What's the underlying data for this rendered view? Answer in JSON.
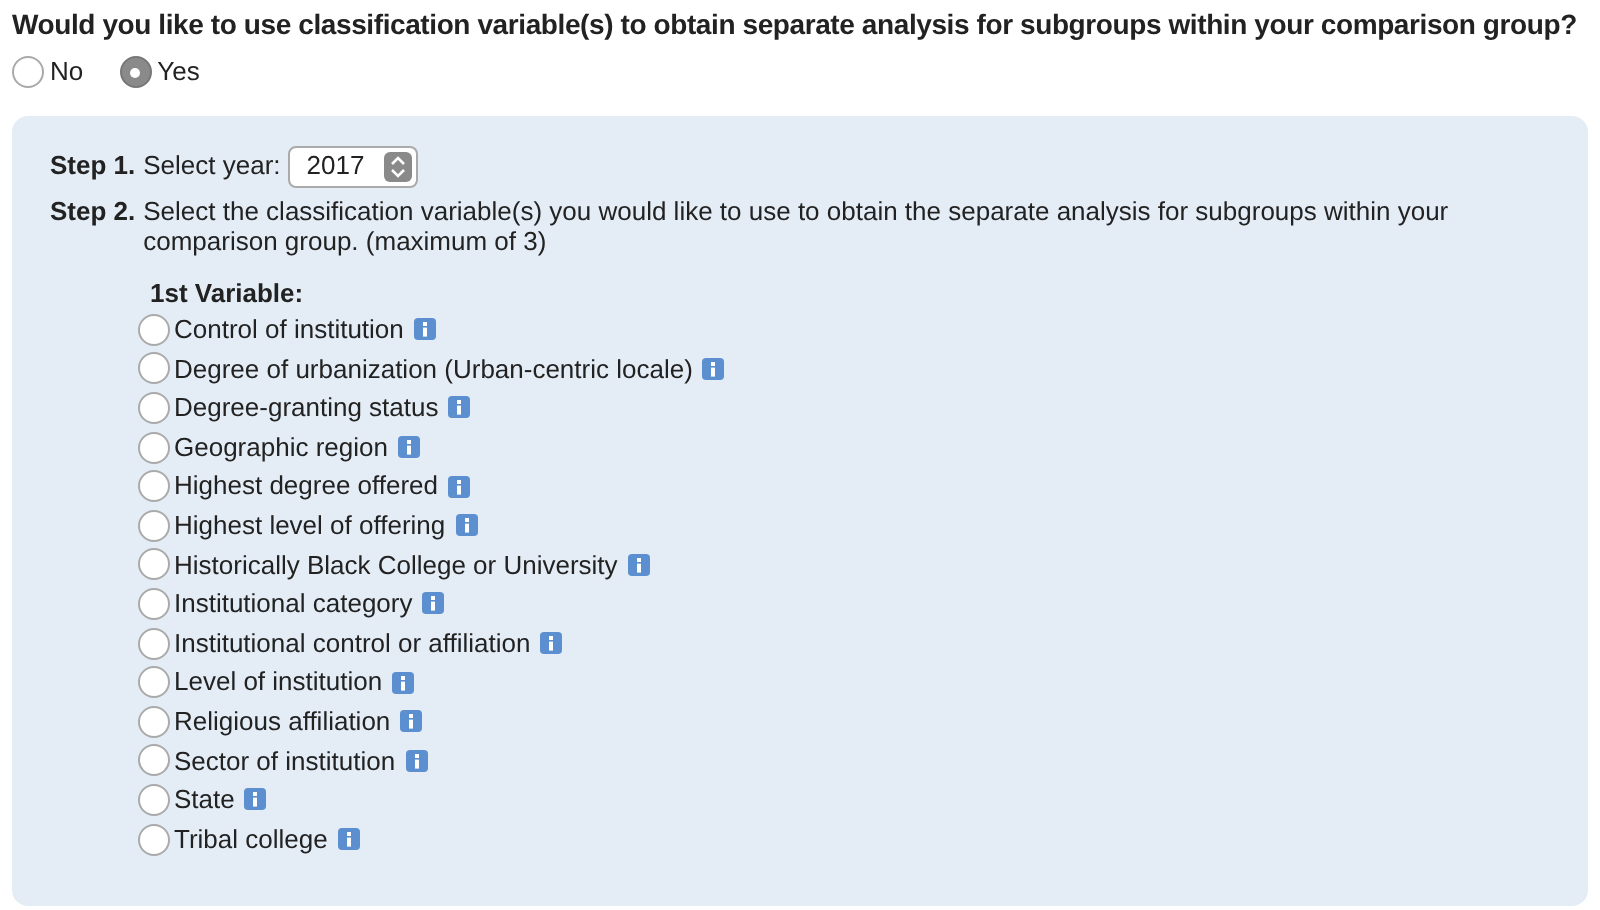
{
  "question": "Would you like to use classification variable(s) to obtain separate analysis for subgroups within your comparison group?",
  "answers": [
    {
      "label": "No",
      "selected": false
    },
    {
      "label": "Yes",
      "selected": true
    }
  ],
  "step1": {
    "step": "Step 1.",
    "label": "Select year:",
    "value": "2017"
  },
  "step2": {
    "step": "Step 2.",
    "text": "Select the classification variable(s) you would like to use to obtain the separate analysis for subgroups within your comparison group. (maximum of 3)"
  },
  "variable_heading": "1st Variable:",
  "options": [
    {
      "label": "Control of institution",
      "selected": false
    },
    {
      "label": "Degree of urbanization (Urban-centric locale)",
      "selected": false
    },
    {
      "label": "Degree-granting status",
      "selected": false
    },
    {
      "label": "Geographic region",
      "selected": false
    },
    {
      "label": "Highest degree offered",
      "selected": false
    },
    {
      "label": "Highest level of offering",
      "selected": false
    },
    {
      "label": "Historically Black College or University",
      "selected": false
    },
    {
      "label": "Institutional category",
      "selected": false
    },
    {
      "label": "Institutional control or affiliation",
      "selected": false
    },
    {
      "label": "Level of institution",
      "selected": false
    },
    {
      "label": "Religious affiliation",
      "selected": false
    },
    {
      "label": "Sector of institution",
      "selected": false
    },
    {
      "label": "State",
      "selected": false
    },
    {
      "label": "Tribal college",
      "selected": false
    }
  ]
}
